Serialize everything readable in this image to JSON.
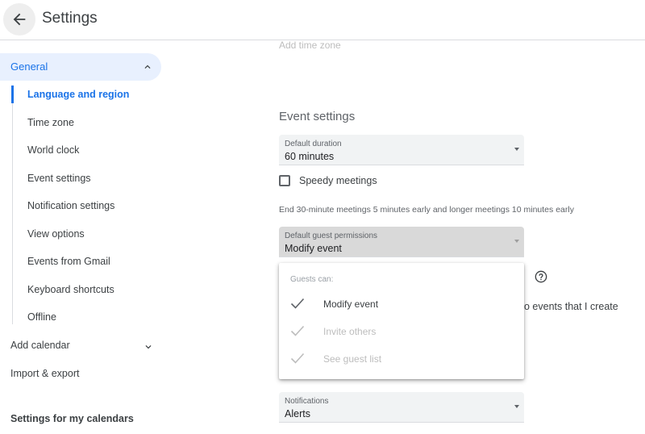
{
  "header": {
    "title": "Settings",
    "back_icon": "arrow-back-icon"
  },
  "sidebar": {
    "general_label": "General",
    "general_items": [
      "Language and region",
      "Time zone",
      "World clock",
      "Event settings",
      "Notification settings",
      "View options",
      "Events from Gmail",
      "Keyboard shortcuts",
      "Offline"
    ],
    "active_item": "Language and region",
    "add_calendar": "Add calendar",
    "import_export": "Import & export",
    "settings_for_my_calendars": "Settings for my calendars"
  },
  "main": {
    "faded_text": "Add time zone",
    "event_settings_title": "Event settings",
    "default_duration": {
      "label": "Default duration",
      "value": "60 minutes"
    },
    "speedy_meetings": {
      "label": "Speedy meetings",
      "checked": false
    },
    "speedy_hint": "End 30-minute meetings 5 minutes early and longer meetings 10 minutes early",
    "guest_permissions": {
      "label": "Default guest permissions",
      "value": "Modify event"
    },
    "behind_text": "o events that I create",
    "notifications": {
      "label": "Notifications",
      "value": "Alerts"
    }
  },
  "dropdown": {
    "header": "Guests can:",
    "options": [
      {
        "label": "Modify event",
        "checked": true,
        "enabled": true
      },
      {
        "label": "Invite others",
        "checked": true,
        "enabled": false
      },
      {
        "label": "See guest list",
        "checked": true,
        "enabled": false
      }
    ]
  },
  "colors": {
    "accent": "#1a73e8",
    "active_bg": "#e8f0fe",
    "field_bg": "#f1f3f4"
  }
}
